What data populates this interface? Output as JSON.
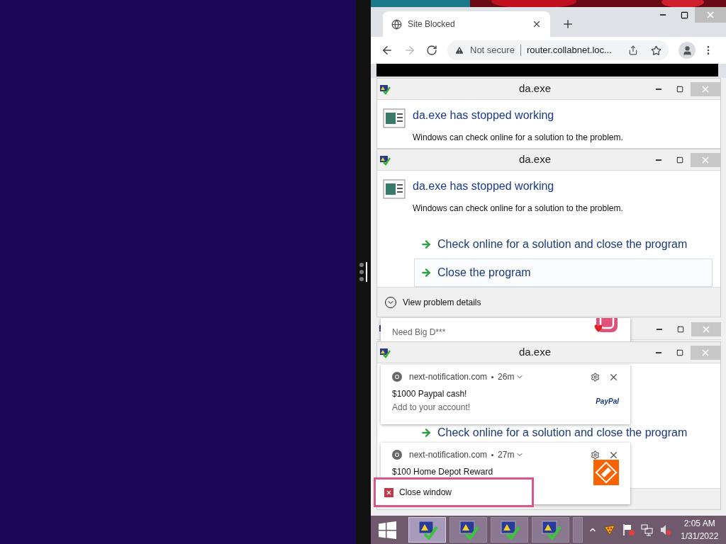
{
  "browser": {
    "tab": {
      "title": "Site Blocked",
      "selected": true
    },
    "address": {
      "security": "Not secure",
      "url": "router.collabnet.loc..."
    }
  },
  "error_dialogs": [
    {
      "title": "da.exe",
      "heading": "da.exe has stopped working",
      "message": "Windows can check online for a solution to the problem."
    },
    {
      "title": "da.exe",
      "heading": "da.exe has stopped working",
      "message": "Windows can check online for a solution to the problem.",
      "options": [
        {
          "label": "Check online for a solution and close the program",
          "highlighted": false
        },
        {
          "label": "Close the program",
          "highlighted": true
        }
      ],
      "details": "View problem details"
    },
    {
      "title": "da.exe",
      "options": [
        {
          "label": "Check online for a solution and close the program",
          "highlighted": false
        }
      ]
    }
  ],
  "notifications": [
    {
      "kind": "instagram",
      "body": "Need Big D***"
    },
    {
      "kind": "paypal",
      "source": "next-notification.com",
      "age": "26m",
      "title": "$1000 Paypal cash!",
      "body": "Add to your account!",
      "logo": "PayPal"
    },
    {
      "kind": "homedepot",
      "source": "next-notification.com",
      "age": "27m",
      "title": "$100 Home Depot Reward"
    }
  ],
  "popup": {
    "label": "Close window"
  },
  "taskbar": {
    "apps": [
      {
        "selected": true
      },
      {
        "selected": false
      },
      {
        "selected": false
      },
      {
        "selected": false
      }
    ],
    "time": "2:05 AM",
    "date": "1/31/2022"
  }
}
